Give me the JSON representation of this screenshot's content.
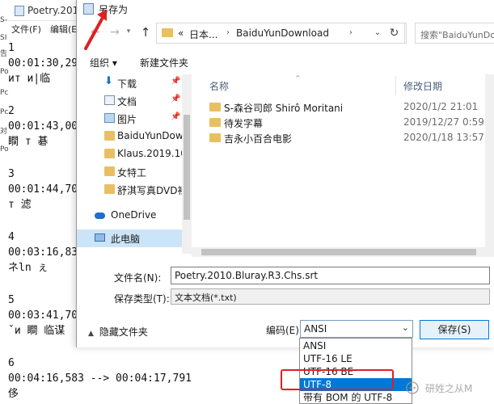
{
  "background_app": {
    "title": "Poetry.2010",
    "menu": [
      "文件(F)",
      "编辑(E)"
    ],
    "left_strip": [
      "S-",
      "SI",
      "告",
      "Po",
      "Pc",
      "Pc",
      "对",
      "Po"
    ],
    "lines": [
      "1",
      "00:01:30,292",
      "ит      и|临",
      "2",
      "00:01:43,000",
      "    瞷   т  碁",
      "3",
      "00:01:44,708",
      "т    滤",
      "4",
      "00:03:16,833",
      "      ネln ぇ",
      "5",
      "00:03:41,708",
      "ˇи  瞷   临谋",
      "6",
      "00:04:16,583 --> 00:04:17,791",
      "侈"
    ]
  },
  "dialog": {
    "title": "另存为",
    "address": {
      "overflow": "«",
      "crumbs": [
        "日本...",
        "BaiduYunDownload"
      ]
    },
    "search_placeholder": "搜索\"BaiduYunDo...",
    "toolbar": {
      "organize": "组织 ▾",
      "new_folder": "新建文件夹"
    },
    "nav_items": [
      {
        "label": "下载",
        "icon": "download-arrow-icon",
        "pinned": true
      },
      {
        "label": "文档",
        "icon": "document-icon",
        "pinned": true
      },
      {
        "label": "图片",
        "icon": "picture-icon",
        "pinned": true
      },
      {
        "label": "BaiduYunDown",
        "icon": "folder-icon",
        "pinned": false
      },
      {
        "label": "Klaus.2019.108",
        "icon": "folder-icon",
        "pinned": false
      },
      {
        "label": "女特工",
        "icon": "folder-icon",
        "pinned": false
      },
      {
        "label": "舒淇写真DVD裸",
        "icon": "folder-icon",
        "pinned": false
      },
      {
        "label": "OneDrive",
        "icon": "cloud-icon",
        "pinned": false
      },
      {
        "label": "此电脑",
        "icon": "computer-icon",
        "pinned": false
      }
    ],
    "columns": {
      "name": "名称",
      "date": "修改日期"
    },
    "files": [
      {
        "name": "S-森谷司郎 Shirô Moritani",
        "date": "2020/1/2 21:01"
      },
      {
        "name": "待发字幕",
        "date": "2019/12/27 0:59"
      },
      {
        "name": "吉永小百合电影",
        "date": "2020/1/18 13:57"
      }
    ],
    "filename_label": "文件名(N):",
    "filename_value": "Poetry.2010.Bluray.R3.Chs.srt",
    "filetype_label": "保存类型(T):",
    "filetype_value": "文本文档(*.txt)",
    "hide_folders": "隐藏文件夹",
    "encoding_label": "编码(E):",
    "encoding_value": "ANSI",
    "save_label": "保存(S)",
    "encoding_options": [
      "ANSI",
      "UTF-16 LE",
      "UTF-16 BE",
      "UTF-8",
      "带有 BOM 的 UTF-8"
    ],
    "selected_encoding": "UTF-8"
  },
  "watermark": "研姓之从M",
  "colors": {
    "accent": "#0078d7",
    "folder": "#e8c063",
    "annotation": "#e02020"
  }
}
